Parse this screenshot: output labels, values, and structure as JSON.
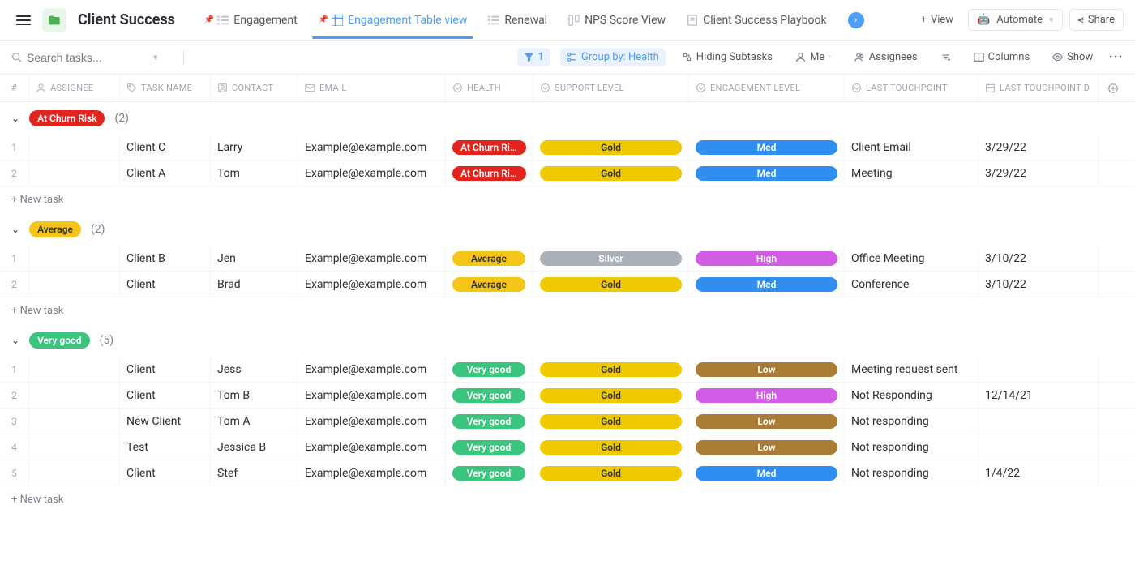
{
  "header": {
    "title": "Client Success",
    "tabs": [
      {
        "label": "Engagement",
        "type": "list"
      },
      {
        "label": "Engagement Table view",
        "type": "table",
        "active": true
      },
      {
        "label": "Renewal",
        "type": "list"
      },
      {
        "label": "NPS Score View",
        "type": "board"
      },
      {
        "label": "Client Success Playbook",
        "type": "doc"
      }
    ],
    "view_btn": "View",
    "automate_btn": "Automate",
    "share_btn": "Share"
  },
  "filters": {
    "search_placeholder": "Search tasks...",
    "filter_count": "1",
    "group_by": "Group by: Health",
    "subtasks": "Hiding Subtasks",
    "me": "Me",
    "assignees": "Assignees",
    "columns": "Columns",
    "show": "Show"
  },
  "columns": {
    "num": "#",
    "assignee": "ASSIGNEE",
    "task": "TASK NAME",
    "contact": "CONTACT",
    "email": "EMAIL",
    "health": "HEALTH",
    "support": "SUPPORT LEVEL",
    "engage": "ENGAGEMENT LEVEL",
    "touch": "LAST TOUCHPOINT",
    "date": "LAST TOUCHPOINT D"
  },
  "colors": {
    "at_churn": "#e2241f",
    "average": "#f5c518",
    "very_good": "#3ac47d",
    "gold": "#f0c800",
    "silver": "#aab0b8",
    "med": "#2f8ef0",
    "high": "#d35ce6",
    "low": "#a87c34"
  },
  "groups": [
    {
      "name": "At Churn Risk",
      "color_key": "at_churn",
      "count": "(2)",
      "rows": [
        {
          "n": "1",
          "task": "Client C",
          "contact": "Larry",
          "email": "Example@example.com",
          "health": "At Churn Ri...",
          "health_key": "at_churn",
          "support": "Gold",
          "support_key": "gold",
          "engage": "Med",
          "engage_key": "med",
          "touch": "Client Email",
          "date": "3/29/22"
        },
        {
          "n": "2",
          "task": "Client A",
          "contact": "Tom",
          "email": "Example@example.com",
          "health": "At Churn Ri...",
          "health_key": "at_churn",
          "support": "Gold",
          "support_key": "gold",
          "engage": "Med",
          "engage_key": "med",
          "touch": "Meeting",
          "date": "3/29/22"
        }
      ]
    },
    {
      "name": "Average",
      "color_key": "average",
      "count": "(2)",
      "rows": [
        {
          "n": "1",
          "task": "Client B",
          "contact": "Jen",
          "email": "Example@example.com",
          "health": "Average",
          "health_key": "average",
          "support": "Silver",
          "support_key": "silver",
          "engage": "High",
          "engage_key": "high",
          "touch": "Office Meeting",
          "date": "3/10/22"
        },
        {
          "n": "2",
          "task": "Client",
          "contact": "Brad",
          "email": "Example@example.com",
          "health": "Average",
          "health_key": "average",
          "support": "Gold",
          "support_key": "gold",
          "engage": "Med",
          "engage_key": "med",
          "touch": "Conference",
          "date": "3/10/22"
        }
      ]
    },
    {
      "name": "Very good",
      "color_key": "very_good",
      "count": "(5)",
      "rows": [
        {
          "n": "1",
          "task": "Client",
          "contact": "Jess",
          "email": "Example@example.com",
          "health": "Very good",
          "health_key": "very_good",
          "support": "Gold",
          "support_key": "gold",
          "engage": "Low",
          "engage_key": "low",
          "touch": "Meeting request sent",
          "date": ""
        },
        {
          "n": "2",
          "task": "Client",
          "contact": "Tom B",
          "email": "Example@example.com",
          "health": "Very good",
          "health_key": "very_good",
          "support": "Gold",
          "support_key": "gold",
          "engage": "High",
          "engage_key": "high",
          "touch": "Not Responding",
          "date": "12/14/21"
        },
        {
          "n": "3",
          "task": "New Client",
          "contact": "Tom A",
          "email": "Example@example.com",
          "health": "Very good",
          "health_key": "very_good",
          "support": "Gold",
          "support_key": "gold",
          "engage": "Low",
          "engage_key": "low",
          "touch": "Not responding",
          "date": ""
        },
        {
          "n": "4",
          "task": "Test",
          "contact": "Jessica B",
          "email": "Example@example.com",
          "health": "Very good",
          "health_key": "very_good",
          "support": "Gold",
          "support_key": "gold",
          "engage": "Low",
          "engage_key": "low",
          "touch": "Not responding",
          "date": ""
        },
        {
          "n": "5",
          "task": "Client",
          "contact": "Stef",
          "email": "Example@example.com",
          "health": "Very good",
          "health_key": "very_good",
          "support": "Gold",
          "support_key": "gold",
          "engage": "Med",
          "engage_key": "med",
          "touch": "Not responding",
          "date": "1/4/22"
        }
      ]
    }
  ],
  "new_task_label": "+ New task"
}
